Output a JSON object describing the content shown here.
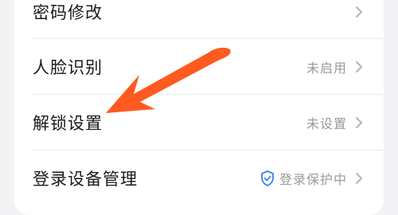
{
  "settings": {
    "rows": [
      {
        "label": "密码修改",
        "value": "",
        "chevron_icon": "chevron-right-icon"
      },
      {
        "label": "人脸识别",
        "value": "未启用",
        "chevron_icon": "chevron-right-icon"
      },
      {
        "label": "解锁设置",
        "value": "未设置",
        "chevron_icon": "chevron-right-icon"
      },
      {
        "label": "登录设备管理",
        "value": "登录保护中",
        "status_icon": "shield-check-icon",
        "chevron_icon": "chevron-right-icon"
      }
    ]
  },
  "colors": {
    "background": "#f3f3f5",
    "card": "#ffffff",
    "label_text": "#1a1a1a",
    "value_text": "#9a9a9a",
    "chevron": "#b5b5b5",
    "shield": "#3d7ef5",
    "annotation_arrow": "#ff5a1f"
  },
  "annotation": {
    "type": "arrow",
    "points_to": "解锁设置"
  }
}
